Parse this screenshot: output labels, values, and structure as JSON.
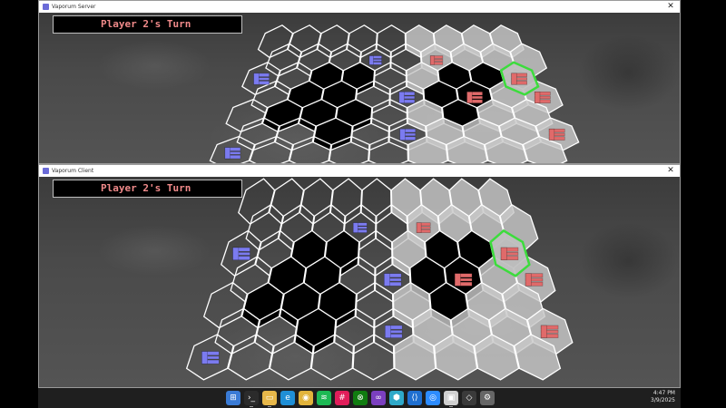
{
  "server_window": {
    "title": "Vaporum Server",
    "close_glyph": "✕",
    "turn_banner": "Player 2's Turn"
  },
  "client_window": {
    "title": "Vaporum Client",
    "close_glyph": "✕",
    "turn_banner": "Player 2's Turn"
  },
  "colors": {
    "player1_unit": "#7b7bf0",
    "player2_unit": "#e06a6a",
    "selected_hex": "#3cdc3c",
    "turn_text": "#f08a8a",
    "grid_line": "#ffffff"
  },
  "units": {
    "player1": [
      "e-mech-icon",
      "e-mech-icon",
      "e-mech-icon",
      "e-mech-icon",
      "e-mech-icon"
    ],
    "player2": [
      "e-mech-icon",
      "e-mech-icon",
      "e-mech-icon",
      "e-mech-icon",
      "e-mech-icon"
    ]
  },
  "taskbar": {
    "icons": [
      "windows-start-icon",
      "terminal-icon",
      "file-explorer-icon",
      "edge-icon",
      "chrome-icon",
      "spotify-icon",
      "slack-icon",
      "xbox-icon",
      "visual-studio-icon",
      "hex-app-icon",
      "vscode-icon",
      "zoom-icon",
      "vaporum-icon",
      "unity-icon",
      "settings-icon"
    ],
    "time": "4:47 PM",
    "date": "3/9/2025"
  }
}
